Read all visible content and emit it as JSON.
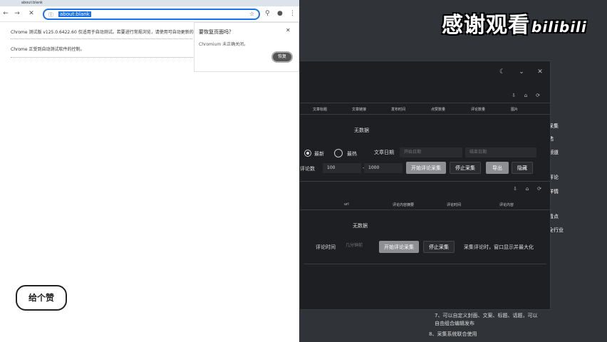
{
  "chrome": {
    "tab_title": "about:blank",
    "url": "about:blank",
    "info_bar": "Chrome 测试版 v125.0.6422.60 仅适用于自动测试。若要进行常规浏览，请使用可自动更新的 Chrome 标准版。",
    "controlled_bar": "Chrome 正受到自动测试软件的控制。",
    "translate_popup": {
      "title": "要恢复页面吗？",
      "body": "Chromium 未正确关闭。",
      "restore_button": "恢复"
    }
  },
  "watermark": {
    "text": "感谢观看",
    "brand": "bilibili"
  },
  "sticker": {
    "text": "给个赞"
  },
  "app": {
    "table1": {
      "headers": [
        "文章标题",
        "文章链接",
        "发布时间",
        "点赞数量",
        "评论数量",
        "图片"
      ],
      "empty_text": "无数据"
    },
    "options": {
      "radio_latest": "最新",
      "radio_hot": "最热",
      "date_label": "文章日期",
      "start_date_placeholder": "开始日期",
      "end_date_placeholder": "结束日期",
      "comment_count_label": "评论数",
      "min_comments": "100",
      "dash": "-",
      "max_comments": "1000"
    },
    "buttons1": {
      "start_comment": "开始评论采集",
      "stop": "停止采集",
      "export": "导出",
      "hide": "隐藏"
    },
    "table2": {
      "headers": [
        "url",
        "评论内容摘要",
        "评论时间",
        "评论内容"
      ],
      "empty_text": "无数据"
    },
    "controls2": {
      "comment_time_label": "评论时间",
      "time_placeholder": "几分钟前",
      "start_comment": "开始评论采集",
      "stop": "停止采集",
      "collect_label": "采集评论时，窗口显示并最大化"
    }
  },
  "background": {
    "right_list": [
      "采集",
      "选",
      "频道",
      "评论",
      "详情",
      "看点",
      "全行业"
    ],
    "bottom_line1": "7、可以自定义封面、文案、标题、话题，可以",
    "bottom_line2": "自由组合编辑发布",
    "bottom_line3": "8、采集系统联合使用"
  },
  "colors": {
    "accent": "#1a73e8",
    "dialog_bg": "#1e1f22",
    "desktop_bg": "#303338",
    "grey_button": "#8e8f92"
  }
}
